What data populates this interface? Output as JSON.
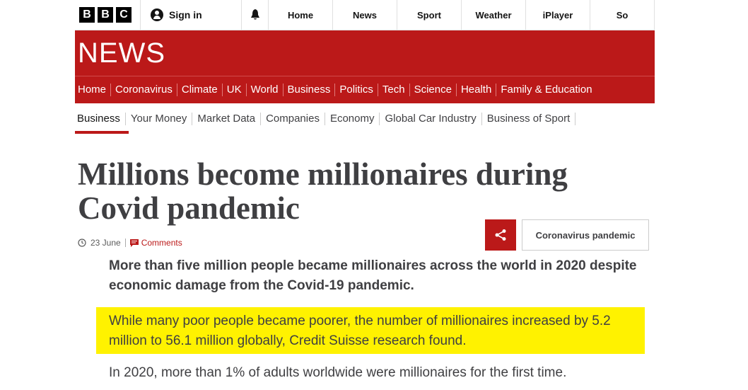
{
  "bbc_logo": [
    "B",
    "B",
    "C"
  ],
  "signin": "Sign in",
  "top_nav": [
    "Home",
    "News",
    "Sport",
    "Weather",
    "iPlayer",
    "So"
  ],
  "masthead": "NEWS",
  "red_nav": [
    "Home",
    "Coronavirus",
    "Climate",
    "UK",
    "World",
    "Business",
    "Politics",
    "Tech",
    "Science",
    "Health",
    "Family & Education"
  ],
  "sub_nav": [
    "Business",
    "Your Money",
    "Market Data",
    "Companies",
    "Economy",
    "Global Car Industry",
    "Business of Sport"
  ],
  "headline": "Millions become millionaires during Covid pandemic",
  "date": "23 June",
  "comments": "Comments",
  "tag": "Coronavirus pandemic",
  "lead": "More than five million people became millionaires across the world in 2020 despite economic damage from the Covid-19 pandemic.",
  "para1": "While many poor people became poorer, the number of millionaires increased by 5.2 million to 56.1 million globally, Credit Suisse research found.",
  "para2": "In 2020, more than 1% of adults worldwide were millionaires for the first time.",
  "colors": {
    "brand_red": "#bb1919",
    "highlight": "#fff200"
  },
  "icons": [
    "user-icon",
    "bell-icon",
    "clock-icon",
    "comment-icon",
    "share-icon"
  ]
}
